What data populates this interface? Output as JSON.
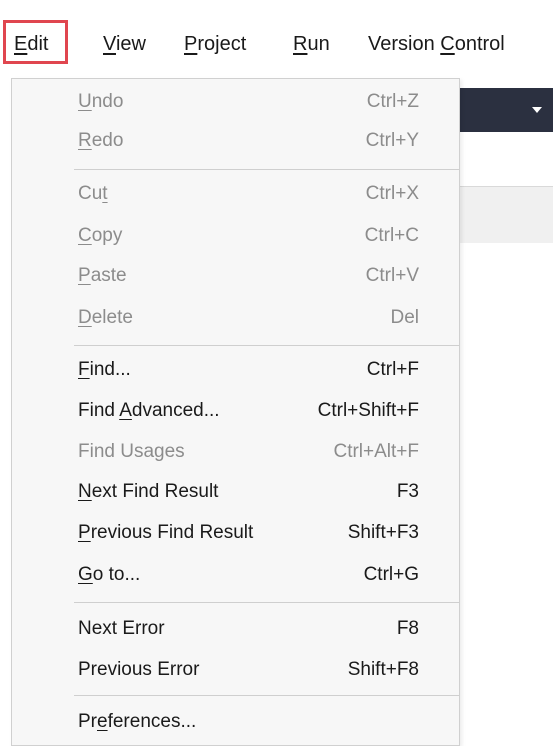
{
  "menubar": {
    "items": [
      {
        "label": "Edit",
        "mnemonic_index": 0,
        "active": true
      },
      {
        "label": "View",
        "mnemonic_index": 0,
        "active": false
      },
      {
        "label": "Project",
        "mnemonic_index": 0,
        "active": false
      },
      {
        "label": "Run",
        "mnemonic_index": 0,
        "active": false
      },
      {
        "label": "Version Control",
        "mnemonic_index": 8,
        "active": false
      }
    ]
  },
  "edit_menu": {
    "items": [
      {
        "label": "Undo",
        "shortcut": "Ctrl+Z",
        "enabled": false,
        "mnemonic_index": 0
      },
      {
        "label": "Redo",
        "shortcut": "Ctrl+Y",
        "enabled": false,
        "mnemonic_index": 0
      },
      {
        "label": "Cut",
        "shortcut": "Ctrl+X",
        "enabled": false,
        "mnemonic_index": 2
      },
      {
        "label": "Copy",
        "shortcut": "Ctrl+C",
        "enabled": false,
        "mnemonic_index": 0
      },
      {
        "label": "Paste",
        "shortcut": "Ctrl+V",
        "enabled": false,
        "mnemonic_index": 0
      },
      {
        "label": "Delete",
        "shortcut": "Del",
        "enabled": false,
        "mnemonic_index": 0
      },
      {
        "label": "Find...",
        "shortcut": "Ctrl+F",
        "enabled": true,
        "mnemonic_index": 0
      },
      {
        "label": "Find Advanced...",
        "shortcut": "Ctrl+Shift+F",
        "enabled": true,
        "mnemonic_index": 5
      },
      {
        "label": "Find Usages",
        "shortcut": "Ctrl+Alt+F",
        "enabled": false,
        "mnemonic_index": -1
      },
      {
        "label": "Next Find Result",
        "shortcut": "F3",
        "enabled": true,
        "mnemonic_index": 0
      },
      {
        "label": "Previous Find Result",
        "shortcut": "Shift+F3",
        "enabled": true,
        "mnemonic_index": 0
      },
      {
        "label": "Go to...",
        "shortcut": "Ctrl+G",
        "enabled": true,
        "mnemonic_index": 0
      },
      {
        "label": "Next Error",
        "shortcut": "F8",
        "enabled": true,
        "mnemonic_index": -1
      },
      {
        "label": "Previous Error",
        "shortcut": "Shift+F8",
        "enabled": true,
        "mnemonic_index": -1
      },
      {
        "label": "Preferences...",
        "shortcut": "",
        "enabled": true,
        "mnemonic_index": 2
      }
    ]
  },
  "colors": {
    "highlight_border": "#e0464f",
    "menu_background": "#f7f7f7",
    "disabled_text": "#8c8c8c",
    "toolbar_background": "#2b3040"
  },
  "icons": [
    "chevron-down-icon"
  ]
}
